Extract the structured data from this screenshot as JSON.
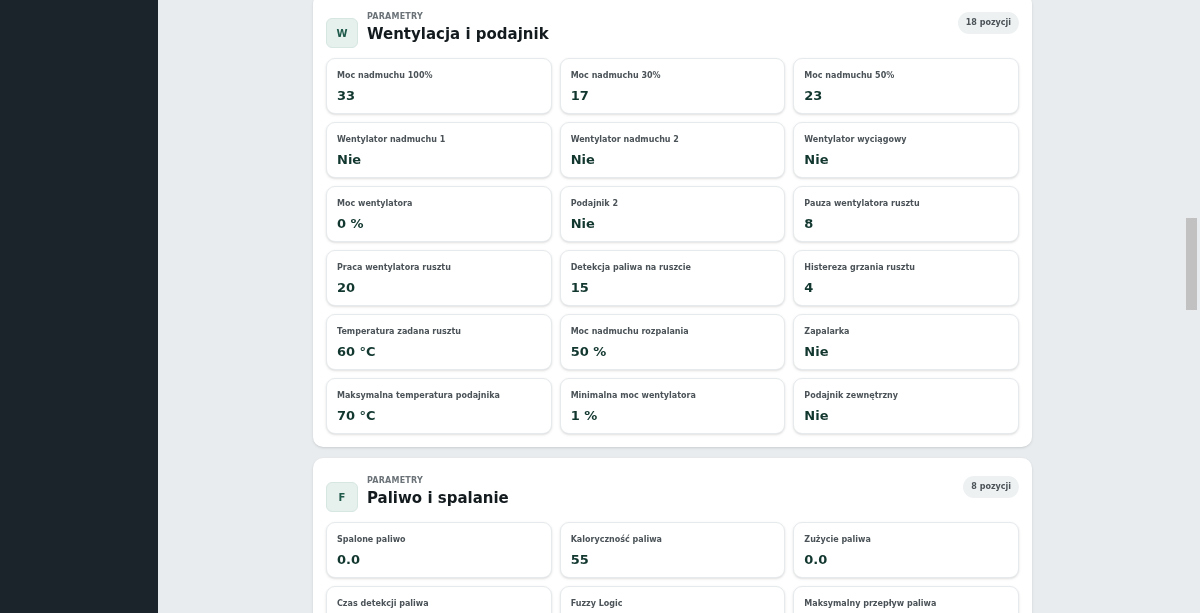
{
  "sections": [
    {
      "icon_letter": "W",
      "eyebrow": "PARAMETRY",
      "title": "Wentylacja i podajnik",
      "count": "18 pozycji",
      "items": [
        {
          "label": "Moc nadmuchu 100%",
          "value": "33"
        },
        {
          "label": "Moc nadmuchu 30%",
          "value": "17"
        },
        {
          "label": "Moc nadmuchu 50%",
          "value": "23"
        },
        {
          "label": "Wentylator nadmuchu 1",
          "value": "Nie"
        },
        {
          "label": "Wentylator nadmuchu 2",
          "value": "Nie"
        },
        {
          "label": "Wentylator wyciągowy",
          "value": "Nie"
        },
        {
          "label": "Moc wentylatora",
          "value": "0 %"
        },
        {
          "label": "Podajnik 2",
          "value": "Nie"
        },
        {
          "label": "Pauza wentylatora rusztu",
          "value": "8"
        },
        {
          "label": "Praca wentylatora rusztu",
          "value": "20"
        },
        {
          "label": "Detekcja paliwa na ruszcie",
          "value": "15"
        },
        {
          "label": "Histereza grzania rusztu",
          "value": "4"
        },
        {
          "label": "Temperatura zadana rusztu",
          "value": "60 °C"
        },
        {
          "label": "Moc nadmuchu rozpalania",
          "value": "50 %"
        },
        {
          "label": "Zapalarka",
          "value": "Nie"
        },
        {
          "label": "Maksymalna temperatura podajnika",
          "value": "70 °C"
        },
        {
          "label": "Minimalna moc wentylatora",
          "value": "1 %"
        },
        {
          "label": "Podajnik zewnętrzny",
          "value": "Nie"
        }
      ]
    },
    {
      "icon_letter": "F",
      "eyebrow": "PARAMETRY",
      "title": "Paliwo i spalanie",
      "count": "8 pozycji",
      "items": [
        {
          "label": "Spalone paliwo",
          "value": "0.0"
        },
        {
          "label": "Kaloryczność paliwa",
          "value": "55"
        },
        {
          "label": "Zużycie paliwa",
          "value": "0.0"
        },
        {
          "label": "Czas detekcji paliwa"
        },
        {
          "label": "Fuzzy Logic"
        },
        {
          "label": "Maksymalny przepływ paliwa"
        }
      ]
    }
  ]
}
